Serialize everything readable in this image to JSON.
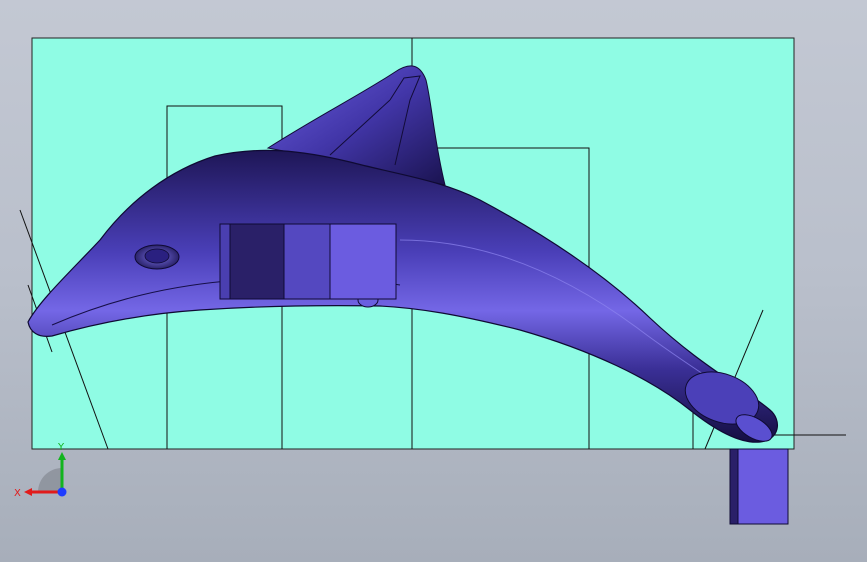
{
  "scene": {
    "background_top": "#c3c8d3",
    "background_bottom": "#a7aeba",
    "sketch_plane_color": "#8ffce4",
    "model_color": "#5b4fd6",
    "model_shadow_color": "#1c1450",
    "block_color": "#6b5ce0",
    "line_color": "#111111"
  },
  "model": {
    "type": "dolphin-body",
    "icon": "dolphin-model"
  },
  "triad": {
    "x_label": "X",
    "y_label": "Y",
    "x_color": "#e11b1b",
    "y_color": "#12b41e",
    "z_color": "#1f3cff"
  }
}
